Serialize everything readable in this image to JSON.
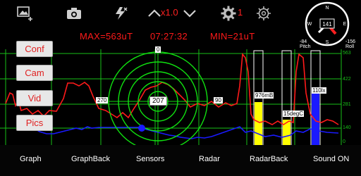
{
  "toolbar": {
    "zoom_value": "x1.0",
    "alert_count": "1"
  },
  "stats": {
    "max": "MAX=563uT",
    "time": "07:27:32",
    "min": "MIN=21uT"
  },
  "compass": {
    "heading": "141",
    "n": "N",
    "e": "E",
    "s": "S",
    "w": "W"
  },
  "pitch_roll": {
    "pitch_value": "-84",
    "pitch_label": "Pitch",
    "roll_value": "-156",
    "roll_label": "Roll"
  },
  "right_axis": [
    "563",
    "422",
    "281",
    "140",
    "0"
  ],
  "radar": {
    "angle_top": "0",
    "angle_left": "270",
    "angle_right": "90",
    "center_value": "207"
  },
  "bars": {
    "pressure": "976mB",
    "temp": "15degC",
    "light": "110lx"
  },
  "side_buttons": [
    "Conf",
    "Cam",
    "Vid",
    "Pics"
  ],
  "tabs": [
    "Graph",
    "GraphBack",
    "Sensors",
    "Radar",
    "RadarBack",
    "Sound ON"
  ],
  "colors": {
    "accent_red": "#ff1a1a",
    "grid_green": "#18c018",
    "radar_green": "#10e010",
    "bar_yellow": "#ffff00",
    "bar_blue": "#1a1aff"
  }
}
